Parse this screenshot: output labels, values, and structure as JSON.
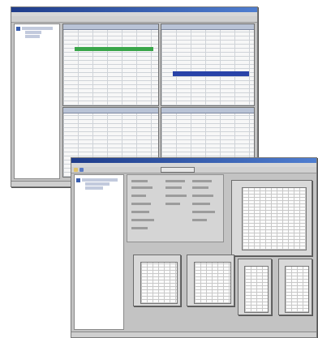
{
  "screenshots": {
    "back": {
      "title": "",
      "highlight_colors": {
        "green": "#3aa64a",
        "blue": "#2943a8"
      },
      "panes": [
        "top-left-grid",
        "top-right-grid",
        "bottom-left-grid",
        "bottom-right-grid"
      ]
    },
    "front": {
      "title": "",
      "mini_frames": [
        "frame-1",
        "frame-2",
        "frame-3",
        "frame-4",
        "frame-5"
      ]
    }
  },
  "colors": {
    "titlebar": "#2b4fa3",
    "window_bg": "#c3c3c3",
    "grid_bg": "#f7f7f7",
    "accent_green": "#3aa64a",
    "accent_blue": "#2943a8"
  }
}
